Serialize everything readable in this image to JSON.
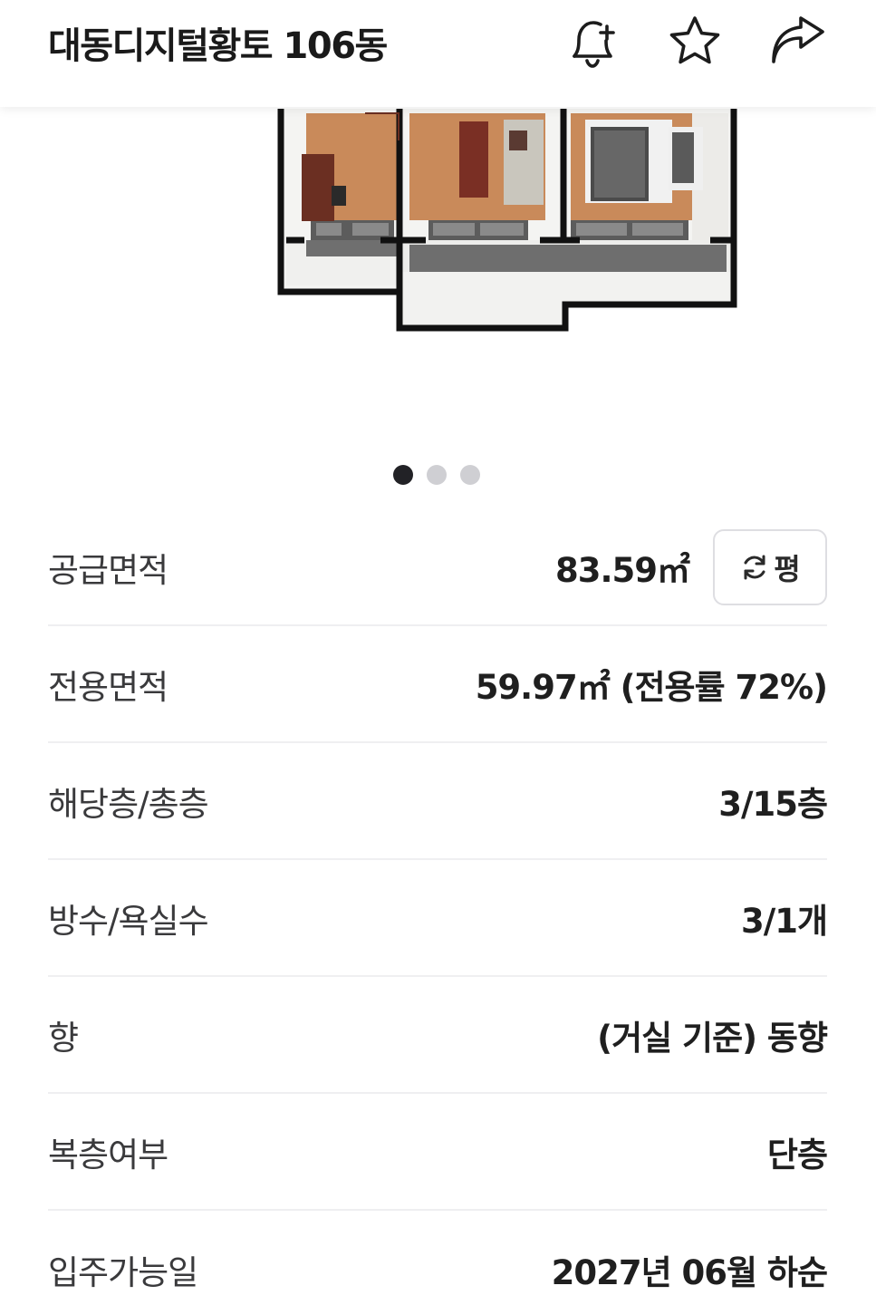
{
  "header": {
    "title": "대동디지털황토 106동",
    "icons": [
      "bell-plus-icon",
      "star-icon",
      "share-arrow-icon"
    ]
  },
  "carousel": {
    "image": "floor-plan-3d-render",
    "total_dots": 3,
    "active_index": 0
  },
  "details": {
    "supply_area": {
      "label": "공급면적",
      "value": "83.59㎡",
      "toggle_label": "평"
    },
    "exclusive_area": {
      "label": "전용면적",
      "value": "59.97㎡ (전용률 72%)"
    },
    "floor": {
      "label": "해당층/총층",
      "value": "3/15층"
    },
    "rooms": {
      "label": "방수/욕실수",
      "value": "3/1개"
    },
    "direction": {
      "label": "향",
      "value": "(거실 기준) 동향"
    },
    "duplex": {
      "label": "복층여부",
      "value": "단층"
    },
    "move_in": {
      "label": "입주가능일",
      "value": "2027년 06월 하순"
    }
  },
  "colors": {
    "text_primary": "#1f1f1f",
    "text_label": "#3a3a3c",
    "divider": "#efeff1",
    "dot_active": "#222226",
    "dot_inactive": "#cfcfd3"
  }
}
